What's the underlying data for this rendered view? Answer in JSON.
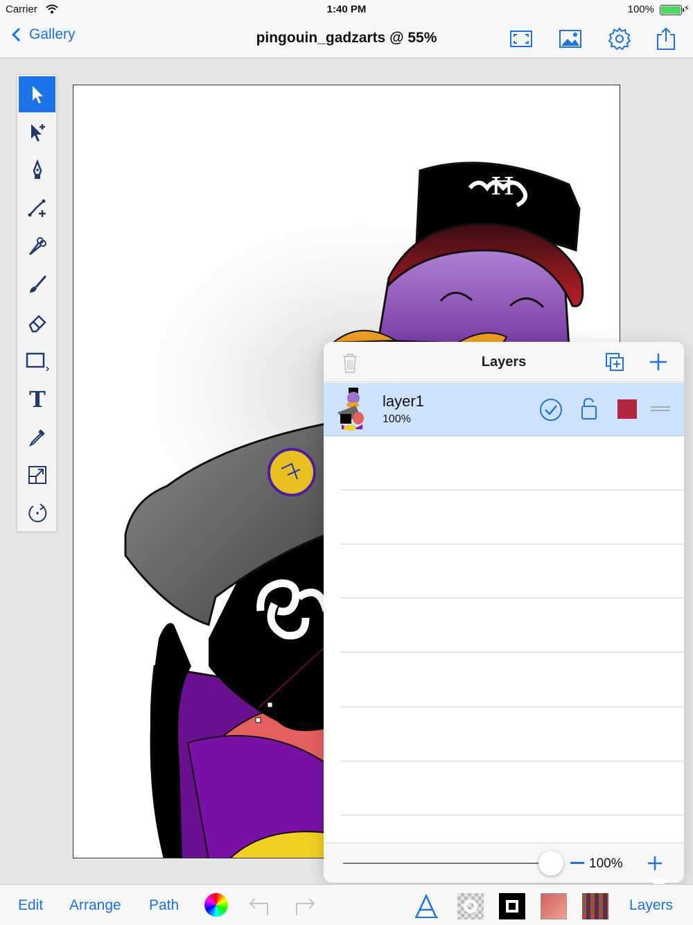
{
  "status_bar": {
    "carrier": "Carrier",
    "time": "1:40 PM",
    "battery": "100%"
  },
  "nav": {
    "back_label": "Gallery",
    "title": "pingouin_gadzarts @ 55%"
  },
  "layers_panel": {
    "title": "Layers",
    "layers": [
      {
        "name": "layer1",
        "opacity": "100%",
        "visible": true,
        "color": "#b3263f"
      }
    ],
    "opacity_value": "100%",
    "opacity_level": 1.0
  },
  "bottom_bar": {
    "edit": "Edit",
    "arrange": "Arrange",
    "path": "Path",
    "layers": "Layers"
  },
  "colors": {
    "accent": "#1a73e8",
    "layer_color": "#b3263f",
    "selected_row": "#cfe2fc"
  }
}
